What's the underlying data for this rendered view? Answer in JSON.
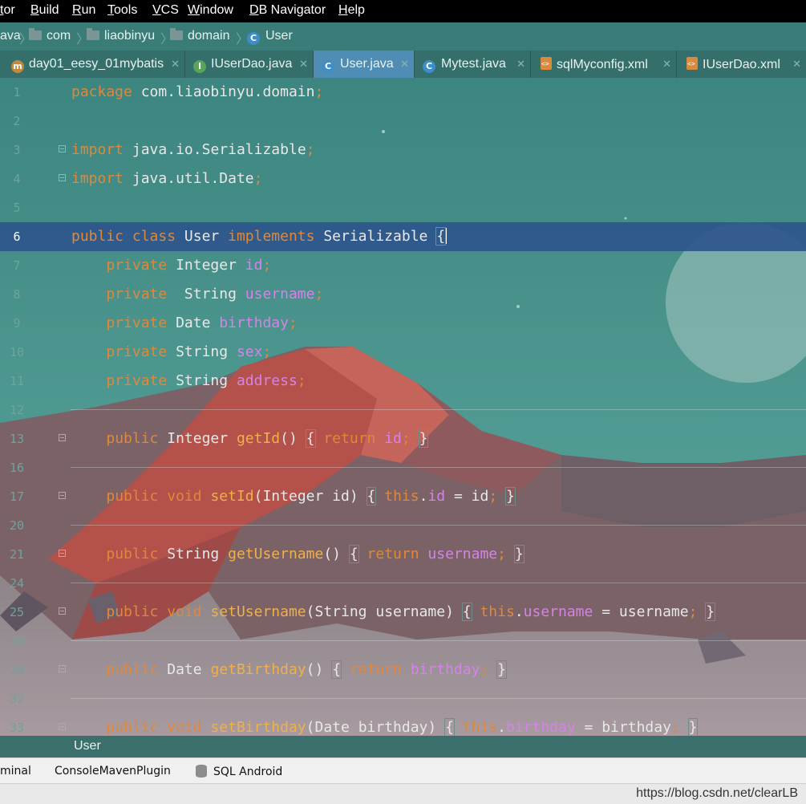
{
  "menubar": {
    "items": [
      "tor",
      "Build",
      "Run",
      "Tools",
      "VCS",
      "Window",
      "DB Navigator",
      "Help"
    ]
  },
  "breadcrumb": {
    "items": [
      "ava",
      "com",
      "liaobinyu",
      "domain",
      "User"
    ]
  },
  "tabs": [
    {
      "label": "day01_eesy_01mybatis",
      "icon": "module-icon"
    },
    {
      "label": "IUserDao.java",
      "icon": "interface-icon"
    },
    {
      "label": "User.java",
      "icon": "class-icon",
      "active": true
    },
    {
      "label": "Mytest.java",
      "icon": "class-icon"
    },
    {
      "label": "sqlMyconfig.xml",
      "icon": "xml-icon"
    },
    {
      "label": "IUserDao.xml",
      "icon": "xml-icon"
    }
  ],
  "editor": {
    "current_line": "6",
    "lines": [
      {
        "n": "1",
        "t": "package com.liaobinyu.domain;"
      },
      {
        "n": "2",
        "t": ""
      },
      {
        "n": "3",
        "t": "import java.io.Serializable;"
      },
      {
        "n": "4",
        "t": "import java.util.Date;"
      },
      {
        "n": "5",
        "t": ""
      },
      {
        "n": "6",
        "t": "public class User implements Serializable {"
      },
      {
        "n": "7",
        "t": "    private Integer id;"
      },
      {
        "n": "8",
        "t": "    private  String username;"
      },
      {
        "n": "9",
        "t": "    private Date birthday;"
      },
      {
        "n": "10",
        "t": "    private String sex;"
      },
      {
        "n": "11",
        "t": "    private String address;"
      },
      {
        "n": "12",
        "t": ""
      },
      {
        "n": "13",
        "t": "    public Integer getId() { return id; }"
      },
      {
        "n": "16",
        "t": ""
      },
      {
        "n": "17",
        "t": "    public void setId(Integer id) { this.id = id; }"
      },
      {
        "n": "20",
        "t": ""
      },
      {
        "n": "21",
        "t": "    public String getUsername() { return username; }"
      },
      {
        "n": "24",
        "t": ""
      },
      {
        "n": "25",
        "t": "    public void setUsername(String username) { this.username = username; }"
      },
      {
        "n": "28",
        "t": ""
      },
      {
        "n": "29",
        "t": "    public Date getBirthday() { return birthday; }"
      },
      {
        "n": "32",
        "t": ""
      },
      {
        "n": "33",
        "t": "    public void setBirthday(Date birthday) { this.birthday = birthday; }"
      }
    ]
  },
  "status_file": "User",
  "tool_windows": [
    "minal",
    "ConsoleMavenPlugin",
    "SQL Android"
  ],
  "watermark": "https://blog.csdn.net/clearLB",
  "colors": {
    "keyword": "#e0883a",
    "field": "#d583e8",
    "method": "#f0b04a",
    "current_line": "#2c548c",
    "active_tab": "#4f8db4"
  }
}
